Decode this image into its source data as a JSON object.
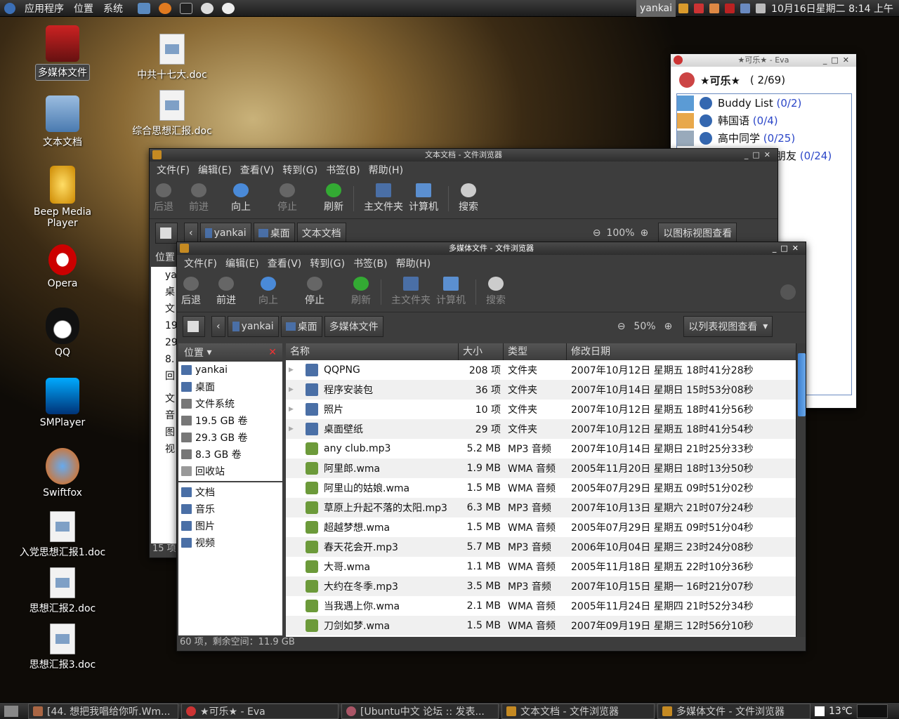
{
  "topbar": {
    "apps": "应用程序",
    "places": "位置",
    "system": "系统",
    "user": "yankai",
    "datetime": "10月16日星期二  8:14 上午"
  },
  "desktop": {
    "icons": [
      {
        "label": "多媒体文件",
        "icon": "multimedia-folder-icon"
      },
      {
        "label": "文本文档",
        "icon": "text-folder-icon"
      },
      {
        "label": "Beep Media Player",
        "icon": "beep-media-player-icon"
      },
      {
        "label": "Opera",
        "icon": "opera-icon"
      },
      {
        "label": "QQ",
        "icon": "qq-penguin-icon"
      },
      {
        "label": "SMPlayer",
        "icon": "smplayer-icon"
      },
      {
        "label": "Swiftfox",
        "icon": "swiftfox-icon"
      },
      {
        "label": "入党思想汇报1.doc",
        "icon": "document-icon"
      },
      {
        "label": "思想汇报2.doc",
        "icon": "document-icon"
      },
      {
        "label": "思想汇报3.doc",
        "icon": "document-icon"
      },
      {
        "label": "中共十七大.doc",
        "icon": "document-icon"
      },
      {
        "label": "综合思想汇报.doc",
        "icon": "document-icon"
      }
    ]
  },
  "eva": {
    "title": "★可乐★ - Eva",
    "nick": "★可乐★",
    "count": "( 2/69)",
    "groups": [
      {
        "name": "Buddy List",
        "count": "(0/2)"
      },
      {
        "name": "韩国语",
        "count": "(0/4)"
      },
      {
        "name": "高中同学",
        "count": "(0/25)"
      },
      {
        "name": "朋友",
        "count": "(0/24)"
      }
    ]
  },
  "back_window": {
    "title": "文本文档 - 文件浏览器",
    "zoom": "100%",
    "view": "以图标视图查看",
    "crumbs": [
      "yankai",
      "桌面",
      "文本文档"
    ],
    "side_head": "位置",
    "side_items": [
      "ya",
      "桌",
      "文",
      "19",
      "29",
      "8.",
      "回",
      "文",
      "音",
      "图",
      "视"
    ],
    "status": "15 项"
  },
  "front_window": {
    "title": "多媒体文件 - 文件浏览器",
    "menu": [
      "文件(F)",
      "编辑(E)",
      "查看(V)",
      "转到(G)",
      "书签(B)",
      "帮助(H)"
    ],
    "toolbar": {
      "back": "后退",
      "forward": "前进",
      "up": "向上",
      "stop": "停止",
      "refresh": "刷新",
      "home": "主文件夹",
      "computer": "计算机",
      "search": "搜索"
    },
    "crumbs": [
      "yankai",
      "桌面",
      "多媒体文件"
    ],
    "zoom": "50%",
    "view": "以列表视图查看",
    "side_head": "位置",
    "places": [
      "yankai",
      "桌面",
      "文件系统",
      "19.5 GB 卷",
      "29.3 GB 卷",
      "8.3 GB 卷",
      "回收站"
    ],
    "bookmarks": [
      "文档",
      "音乐",
      "图片",
      "视频"
    ],
    "columns": {
      "name": "名称",
      "size": "大小",
      "type": "类型",
      "date": "修改日期"
    },
    "files": [
      {
        "name": "QQPNG",
        "size": "208 项",
        "type": "文件夹",
        "date": "2007年10月12日 星期五 18时41分28秒",
        "kind": "folder"
      },
      {
        "name": "程序安装包",
        "size": "36 项",
        "type": "文件夹",
        "date": "2007年10月14日 星期日 15时53分08秒",
        "kind": "folder"
      },
      {
        "name": "照片",
        "size": "10 项",
        "type": "文件夹",
        "date": "2007年10月12日 星期五 18时41分56秒",
        "kind": "folder"
      },
      {
        "name": "桌面壁纸",
        "size": "29 项",
        "type": "文件夹",
        "date": "2007年10月12日 星期五 18时41分54秒",
        "kind": "folder"
      },
      {
        "name": "any club.mp3",
        "size": "5.2 MB",
        "type": "MP3 音频",
        "date": "2007年10月14日 星期日 21时25分33秒",
        "kind": "audio"
      },
      {
        "name": "阿里郎.wma",
        "size": "1.9 MB",
        "type": "WMA 音频",
        "date": "2005年11月20日 星期日 18时13分50秒",
        "kind": "audio"
      },
      {
        "name": "阿里山的姑娘.wma",
        "size": "1.5 MB",
        "type": "WMA 音频",
        "date": "2005年07月29日 星期五 09时51分02秒",
        "kind": "audio"
      },
      {
        "name": "草原上升起不落的太阳.mp3",
        "size": "6.3 MB",
        "type": "MP3 音频",
        "date": "2007年10月13日 星期六 21时07分24秒",
        "kind": "audio"
      },
      {
        "name": "超越梦想.wma",
        "size": "1.5 MB",
        "type": "WMA 音频",
        "date": "2005年07月29日 星期五 09时51分04秒",
        "kind": "audio"
      },
      {
        "name": "春天花会开.mp3",
        "size": "5.7 MB",
        "type": "MP3 音频",
        "date": "2006年10月04日 星期三 23时24分08秒",
        "kind": "audio"
      },
      {
        "name": "大哥.wma",
        "size": "1.1 MB",
        "type": "WMA 音频",
        "date": "2005年11月18日 星期五 22时10分36秒",
        "kind": "audio"
      },
      {
        "name": "大约在冬季.mp3",
        "size": "3.5 MB",
        "type": "MP3 音频",
        "date": "2007年10月15日 星期一 16时21分07秒",
        "kind": "audio"
      },
      {
        "name": "当我遇上你.wma",
        "size": "2.1 MB",
        "type": "WMA 音频",
        "date": "2005年11月24日 星期四 21时52分34秒",
        "kind": "audio"
      },
      {
        "name": "刀剑如梦.wma",
        "size": "1.5 MB",
        "type": "WMA 音频",
        "date": "2007年09月19日 星期三 12时56分10秒",
        "kind": "audio"
      }
    ],
    "status": "60 项，剩余空间：11.9 GB"
  },
  "taskbar": {
    "tasks": [
      "[44. 想把我唱给你听.Wm...",
      "★可乐★ - Eva",
      "[Ubuntu中文 论坛 :: 发表...",
      "文本文档 - 文件浏览器",
      "多媒体文件 - 文件浏览器"
    ],
    "weather": "13℃"
  }
}
